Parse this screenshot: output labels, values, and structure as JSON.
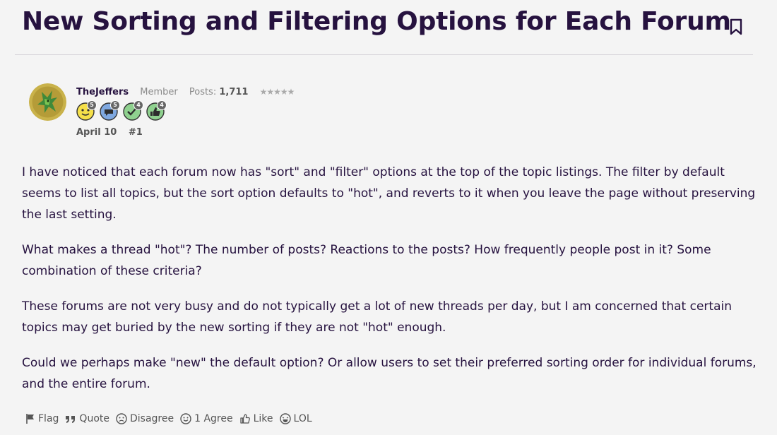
{
  "thread": {
    "title": "New Sorting and Filtering Options for Each Forum"
  },
  "post": {
    "author": "TheJeffers",
    "role": "Member",
    "posts_label": "Posts:",
    "posts_count": "1,711",
    "stars": "★★★★★",
    "date": "April 10",
    "number": "#1",
    "badges": [
      {
        "icon": "smiley-badge-icon",
        "count": "5",
        "color": "#f5e04a"
      },
      {
        "icon": "speech-bubble-badge-icon",
        "count": "5",
        "color": "#7fa8e0"
      },
      {
        "icon": "checkmark-badge-icon",
        "count": "4",
        "color": "#8fd18f"
      },
      {
        "icon": "thumbs-up-badge-icon",
        "count": "4",
        "color": "#8fd18f"
      }
    ],
    "paragraphs": [
      "I have noticed that each forum now has \"sort\" and \"filter\" options at the top of the topic listings. The filter by default seems to list all topics, but the sort option defaults to \"hot\", and reverts to it when you leave the page without preserving the last setting.",
      "What makes a thread \"hot\"? The number of posts? Reactions to the posts? How frequently people post in it? Some combination of these criteria?",
      "These forums are not very busy and do not typically get a lot of new threads per day, but I am concerned that certain topics may get buried by the new sorting if they are not \"hot\" enough.",
      "Could we perhaps make \"new\" the default option? Or allow users to set their preferred sorting order for individual forums, and the entire forum."
    ]
  },
  "actions": {
    "flag": "Flag",
    "quote": "Quote",
    "disagree": "Disagree",
    "agree": "1 Agree",
    "like": "Like",
    "lol": "LOL"
  }
}
